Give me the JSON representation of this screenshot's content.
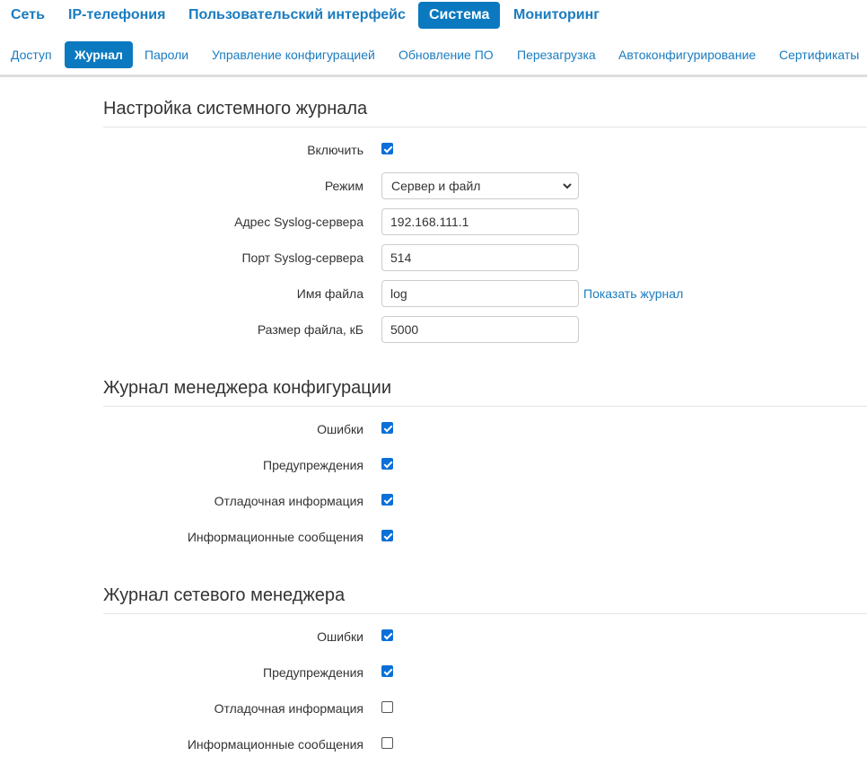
{
  "top_nav": {
    "items": [
      {
        "label": "Сеть"
      },
      {
        "label": "IP-телефония"
      },
      {
        "label": "Пользовательский интерфейс"
      },
      {
        "label": "Система",
        "active": true
      },
      {
        "label": "Мониторинг"
      }
    ]
  },
  "sub_nav": {
    "items": [
      {
        "label": "Доступ"
      },
      {
        "label": "Журнал",
        "active": true
      },
      {
        "label": "Пароли"
      },
      {
        "label": "Управление конфигурацией"
      },
      {
        "label": "Обновление ПО"
      },
      {
        "label": "Перезагрузка"
      },
      {
        "label": "Автоконфигурирование"
      },
      {
        "label": "Сертификаты"
      }
    ]
  },
  "syslog": {
    "title": "Настройка системного журнала",
    "enable": {
      "label": "Включить",
      "checked": true
    },
    "mode": {
      "label": "Режим",
      "value": "Сервер и файл"
    },
    "server_address": {
      "label": "Адрес Syslog-сервера",
      "value": "192.168.111.1"
    },
    "server_port": {
      "label": "Порт Syslog-сервера",
      "value": "514"
    },
    "file_name": {
      "label": "Имя файла",
      "value": "log",
      "link": "Показать журнал"
    },
    "file_size": {
      "label": "Размер файла, кБ",
      "value": "5000"
    }
  },
  "config_manager_log": {
    "title": "Журнал менеджера конфигурации",
    "errors": {
      "label": "Ошибки",
      "checked": true
    },
    "warnings": {
      "label": "Предупреждения",
      "checked": true
    },
    "debug": {
      "label": "Отладочная информация",
      "checked": true
    },
    "info": {
      "label": "Информационные сообщения",
      "checked": true
    }
  },
  "network_manager_log": {
    "title": "Журнал сетевого менеджера",
    "errors": {
      "label": "Ошибки",
      "checked": true
    },
    "warnings": {
      "label": "Предупреждения",
      "checked": true
    },
    "debug": {
      "label": "Отладочная информация",
      "checked": false
    },
    "info": {
      "label": "Информационные сообщения",
      "checked": false
    }
  },
  "colors": {
    "accent": "#0b79c0",
    "link": "#1a7cc0",
    "checkbox": "#0b6fd8"
  },
  "icons": {
    "select_arrow": "chevron-down-icon",
    "checkbox_mark": "check-icon"
  }
}
